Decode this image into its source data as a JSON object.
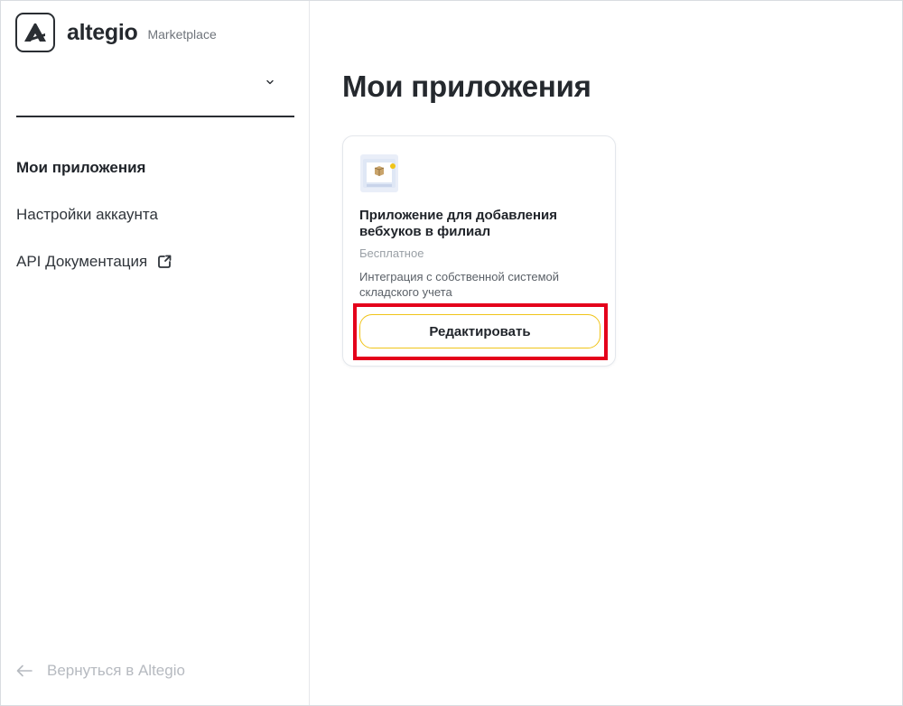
{
  "brand": {
    "name": "altegio",
    "subtitle": "Marketplace"
  },
  "branch_select": {
    "value": ""
  },
  "nav": {
    "items": [
      {
        "label": "Мои приложения",
        "active": true
      },
      {
        "label": "Настройки аккаунта",
        "active": false
      },
      {
        "label": "API Документация",
        "active": false,
        "external": true
      }
    ]
  },
  "footer": {
    "back_label": "Вернуться в Altegio"
  },
  "main": {
    "title": "Мои приложения",
    "apps": [
      {
        "name": "Приложение для добавления вебхуков в филиал",
        "price": "Бесплатное",
        "description": "Интеграция с собственной системой складского учета",
        "action_label": "Редактировать",
        "icon": "box-app-icon"
      }
    ]
  },
  "colors": {
    "accent_yellow": "#f0c419",
    "highlight_red": "#e4001b",
    "text_dark": "#1f2329",
    "text_muted": "#9aa0a6"
  }
}
